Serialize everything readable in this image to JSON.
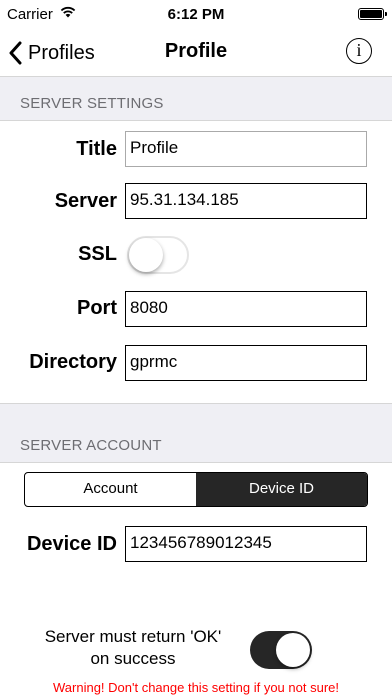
{
  "status_bar": {
    "carrier": "Carrier",
    "time": "6:12 PM"
  },
  "nav": {
    "back_label": "Profiles",
    "title": "Profile",
    "info_glyph": "i"
  },
  "server_settings": {
    "header": "SERVER SETTINGS",
    "title_label": "Title",
    "title_value": "Profile",
    "server_label": "Server",
    "server_value": "95.31.134.185",
    "ssl_label": "SSL",
    "ssl_on": false,
    "port_label": "Port",
    "port_value": "8080",
    "directory_label": "Directory",
    "directory_value": "gprmc"
  },
  "server_account": {
    "header": "SERVER ACCOUNT",
    "segments": [
      "Account",
      "Device ID"
    ],
    "selected_segment": "Device ID",
    "device_id_label": "Device ID",
    "device_id_value": "123456789012345"
  },
  "ok_setting": {
    "label_line1": "Server must return 'OK'",
    "label_line2": "on success",
    "toggle_on": true,
    "warning": "Warning! Don't change this setting if you not sure!"
  },
  "colors": {
    "accent_dark": "#262626",
    "section_bg": "#efeff4",
    "section_text": "#6d6d72",
    "warning": "#ff0000"
  },
  "icons": [
    "wifi-icon",
    "battery-icon",
    "chevron-left-icon",
    "info-icon"
  ]
}
